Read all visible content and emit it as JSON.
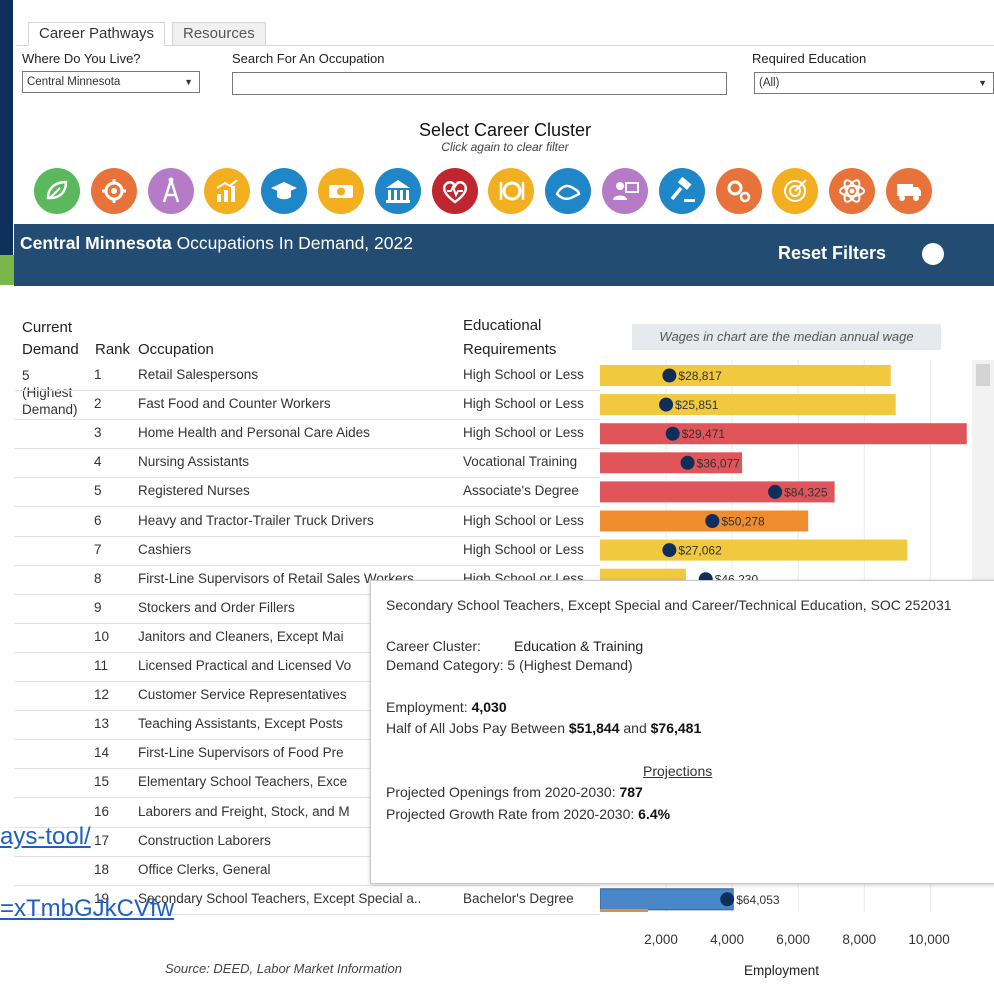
{
  "tabs": [
    {
      "label": "Career Pathways",
      "active": true
    },
    {
      "label": "Resources",
      "active": false
    }
  ],
  "filters": {
    "where_label": "Where Do You Live?",
    "where_value": "Central Minnesota",
    "search_label": "Search For An Occupation",
    "search_value": "",
    "education_label": "Required Education",
    "education_value": "(All)"
  },
  "cluster": {
    "title": "Select Career Cluster",
    "subtitle": "Click again to clear filter",
    "icons": [
      {
        "name": "agriculture-leaf-icon",
        "color": "#5cb85c"
      },
      {
        "name": "manufacturing-gear-icon",
        "color": "#e8733a"
      },
      {
        "name": "communication-tower-icon",
        "color": "#b57bc6"
      },
      {
        "name": "business-chart-icon",
        "color": "#f2b021"
      },
      {
        "name": "education-graduation-cap-icon",
        "color": "#1f86c8"
      },
      {
        "name": "finance-money-icon",
        "color": "#f2b021"
      },
      {
        "name": "government-building-icon",
        "color": "#1f86c8"
      },
      {
        "name": "health-heart-icon",
        "color": "#c0262d"
      },
      {
        "name": "hospitality-plate-icon",
        "color": "#f2b021"
      },
      {
        "name": "human-services-hands-icon",
        "color": "#1f86c8"
      },
      {
        "name": "it-computer-user-icon",
        "color": "#b57bc6"
      },
      {
        "name": "law-gavel-icon",
        "color": "#1f86c8"
      },
      {
        "name": "marketing-gears-icon",
        "color": "#e8733a"
      },
      {
        "name": "stem-target-icon",
        "color": "#f2b021"
      },
      {
        "name": "science-atom-icon",
        "color": "#e8733a"
      },
      {
        "name": "transportation-truck-icon",
        "color": "#e8733a"
      }
    ]
  },
  "banner": {
    "region": "Central Minnesota",
    "title_rest": " Occupations In Demand, 2022",
    "reset_label": "Reset Filters"
  },
  "table": {
    "header": {
      "demand_1": "Current",
      "demand_2": "Demand",
      "rank": "Rank",
      "occupation": "Occupation",
      "edu_1": "Educational",
      "edu_2": "Requirements"
    },
    "wage_note": "Wages in chart are the median annual wage",
    "demand_group": [
      "5",
      "(Highest",
      "Demand)"
    ],
    "rows": [
      {
        "rank": "1",
        "occupation": "Retail Salespersons",
        "education": "High School or Less"
      },
      {
        "rank": "2",
        "occupation": "Fast Food and Counter Workers",
        "education": "High School or Less"
      },
      {
        "rank": "3",
        "occupation": "Home Health and Personal Care Aides",
        "education": "High School or Less"
      },
      {
        "rank": "4",
        "occupation": "Nursing Assistants",
        "education": "Vocational Training"
      },
      {
        "rank": "5",
        "occupation": "Registered Nurses",
        "education": "Associate's Degree"
      },
      {
        "rank": "6",
        "occupation": "Heavy and Tractor-Trailer Truck Drivers",
        "education": "High School or Less"
      },
      {
        "rank": "7",
        "occupation": "Cashiers",
        "education": "High School or Less"
      },
      {
        "rank": "8",
        "occupation": "First-Line Supervisors of Retail Sales Workers",
        "education": "High School or Less"
      },
      {
        "rank": "9",
        "occupation": "Stockers and Order Fillers",
        "education": ""
      },
      {
        "rank": "10",
        "occupation": "Janitors and Cleaners, Except Mai",
        "education": ""
      },
      {
        "rank": "11",
        "occupation": "Licensed Practical and Licensed Vo",
        "education": ""
      },
      {
        "rank": "12",
        "occupation": "Customer Service Representatives",
        "education": ""
      },
      {
        "rank": "13",
        "occupation": "Teaching Assistants, Except Posts",
        "education": ""
      },
      {
        "rank": "14",
        "occupation": "First-Line Supervisors of Food Pre",
        "education": ""
      },
      {
        "rank": "15",
        "occupation": "Elementary School Teachers, Exce",
        "education": ""
      },
      {
        "rank": "16",
        "occupation": "Laborers and Freight, Stock, and M",
        "education": ""
      },
      {
        "rank": "17",
        "occupation": "Construction Laborers",
        "education": ""
      },
      {
        "rank": "18",
        "occupation": "Office Clerks, General",
        "education": ""
      },
      {
        "rank": "19",
        "occupation": "Secondary School Teachers, Except Special a..",
        "education": "Bachelor's Degree"
      }
    ]
  },
  "chart_data": {
    "type": "bar",
    "xlabel": "Employment",
    "xlim": [
      0,
      11500
    ],
    "xticks": [
      "2,000",
      "4,000",
      "6,000",
      "8,000",
      "10,000"
    ],
    "bars": [
      {
        "employment": 8800,
        "wage": "$28,817",
        "wage_pos": 2100,
        "color": "#f0c93e"
      },
      {
        "employment": 8950,
        "wage": "$25,851",
        "wage_pos": 2000,
        "color": "#f0c93e"
      },
      {
        "employment": 11100,
        "wage": "$29,471",
        "wage_pos": 2200,
        "color": "#e0555a"
      },
      {
        "employment": 4300,
        "wage": "$36,077",
        "wage_pos": 2650,
        "color": "#e0555a"
      },
      {
        "employment": 7100,
        "wage": "$84,325",
        "wage_pos": 5300,
        "color": "#e0555a"
      },
      {
        "employment": 6300,
        "wage": "$50,278",
        "wage_pos": 3400,
        "color": "#ef8c2e"
      },
      {
        "employment": 9300,
        "wage": "$27,062",
        "wage_pos": 2100,
        "color": "#f0c93e"
      },
      {
        "employment": 2600,
        "wage": "$46,230",
        "wage_pos": 3200,
        "color": "#f0c93e"
      },
      {
        "employment": 0,
        "wage": "",
        "wage_pos": 0,
        "color": "#f0c93e"
      },
      {
        "employment": 0,
        "wage": "",
        "wage_pos": 0,
        "color": "#f0c93e"
      },
      {
        "employment": 0,
        "wage": "",
        "wage_pos": 0,
        "color": "#f0c93e"
      },
      {
        "employment": 0,
        "wage": "",
        "wage_pos": 0,
        "color": "#f0c93e"
      },
      {
        "employment": 0,
        "wage": "",
        "wage_pos": 0,
        "color": "#f0c93e"
      },
      {
        "employment": 0,
        "wage": "",
        "wage_pos": 0,
        "color": "#f0c93e"
      },
      {
        "employment": 0,
        "wage": "",
        "wage_pos": 0,
        "color": "#f0c93e"
      },
      {
        "employment": 0,
        "wage": "",
        "wage_pos": 0,
        "color": "#f0c93e"
      },
      {
        "employment": 0,
        "wage": "",
        "wage_pos": 0,
        "color": "#f0c93e"
      },
      {
        "employment": 0,
        "wage": "",
        "wage_pos": 0,
        "color": "#f0c93e"
      },
      {
        "employment": 4030,
        "wage": "$64,053",
        "wage_pos": 3850,
        "color": "#4a87c8"
      }
    ],
    "marker_color": "#0d2f5a"
  },
  "tooltip": {
    "title": "Secondary School Teachers, Except Special and Career/Technical Education, SOC 252031",
    "cluster_label": "Career Cluster:",
    "cluster_value": "Education & Training",
    "demand_label": "Demand Category:",
    "demand_value": "5 (Highest Demand)",
    "employment_label": "Employment:",
    "employment_value": "4,030",
    "pay_label": "Half of All Jobs Pay Between",
    "pay_low": "$51,844",
    "pay_and": "and",
    "pay_high": "$76,481",
    "projections_heading": "Projections",
    "openings_label": "Projected Openings from 2020-2030:",
    "openings_value": "787",
    "growth_label": "Projected Growth Rate from 2020-2030:",
    "growth_value": "6.4%"
  },
  "footer": {
    "source": "Source: DEED, Labor Market Information"
  },
  "overlay_links": {
    "link1": "ays-tool/",
    "link2": "=xTmbGJkCVfw"
  }
}
